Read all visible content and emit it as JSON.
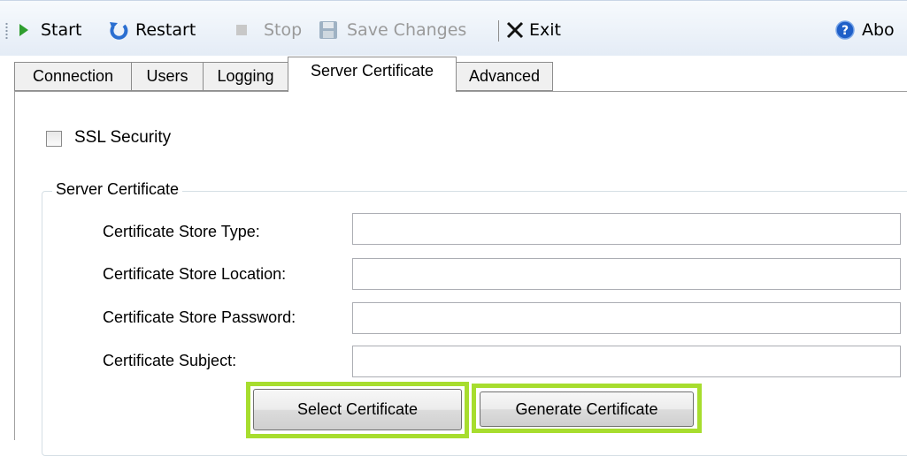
{
  "toolbar": {
    "start_label": "Start",
    "restart_label": "Restart",
    "stop_label": "Stop",
    "save_label": "Save Changes",
    "exit_label": "Exit",
    "about_label": "Abo"
  },
  "icons": {
    "start": "play-icon",
    "restart": "restart-icon",
    "stop": "stop-icon",
    "save": "save-icon",
    "exit": "close-icon",
    "about": "help-icon"
  },
  "tabs": [
    {
      "label": "Connection",
      "active": false
    },
    {
      "label": "Users",
      "active": false
    },
    {
      "label": "Logging",
      "active": false
    },
    {
      "label": "Server Certificate",
      "active": true
    },
    {
      "label": "Advanced",
      "active": false
    }
  ],
  "ssl": {
    "label": "SSL Security",
    "checked": false
  },
  "group": {
    "title": "Server Certificate",
    "fields": [
      {
        "label": "Certificate Store Type:",
        "value": ""
      },
      {
        "label": "Certificate Store Location:",
        "value": ""
      },
      {
        "label": "Certificate Store Password:",
        "value": ""
      },
      {
        "label": "Certificate Subject:",
        "value": ""
      }
    ]
  },
  "buttons": {
    "select_label": "Select Certificate",
    "generate_label": "Generate Certificate"
  },
  "colors": {
    "highlight": "#a7dd2e",
    "start_green": "#2f9e2f",
    "restart_blue": "#2b6fd1",
    "about_blue": "#1f5fc8"
  }
}
